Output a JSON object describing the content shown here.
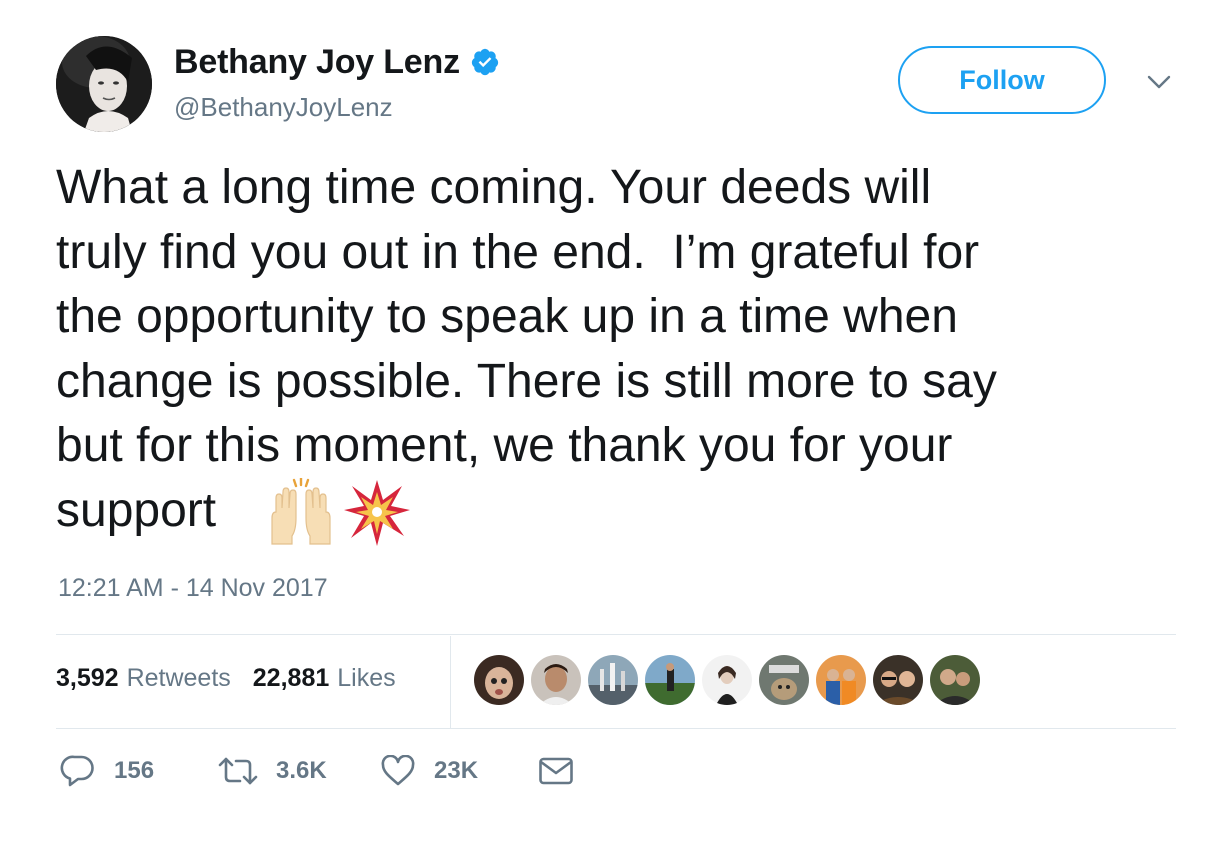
{
  "user": {
    "display_name": "Bethany Joy Lenz",
    "handle": "@BethanyJoyLenz",
    "verified": true,
    "avatar_icon": "profile-photo"
  },
  "header": {
    "follow_label": "Follow",
    "menu_icon": "chevron-down-icon"
  },
  "tweet": {
    "text": "What a long time coming. Your deeds will\ntruly find you out in the end.  I’m grateful for\nthe opportunity to speak up in a time when\nchange is possible. There is still more to say\nbut for this moment, we thank you for your\nsupport",
    "emojis": [
      "raising-hands-emoji",
      "collision-emoji"
    ],
    "timestamp": "12:21 AM - 14 Nov 2017"
  },
  "stats": {
    "retweets_count": "3,592",
    "retweets_label": "Retweets",
    "likes_count": "22,881",
    "likes_label": "Likes",
    "liker_avatars": 9
  },
  "actions": {
    "reply_count": "156",
    "retweet_count": "3.6K",
    "like_count": "23K",
    "reply_icon": "reply-icon",
    "retweet_icon": "retweet-icon",
    "like_icon": "heart-icon",
    "dm_icon": "envelope-icon"
  },
  "colors": {
    "accent": "#1da1f2",
    "text": "#14171a",
    "secondary": "#657786",
    "divider": "#e1e8ed"
  }
}
